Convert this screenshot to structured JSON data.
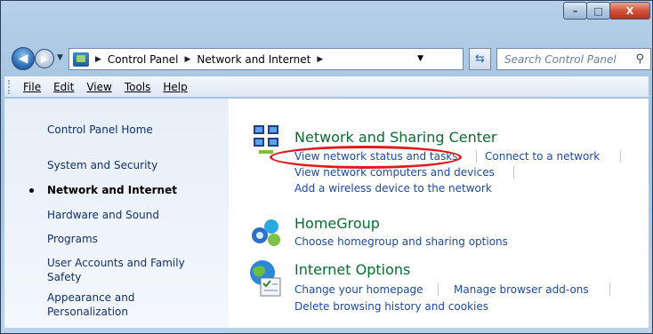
{
  "window": {
    "caption_buttons": [
      "–",
      "□",
      "X"
    ]
  },
  "address_bar": {
    "crumbs": [
      "Control Panel",
      "Network and Internet"
    ],
    "search_placeholder": "Search Control Panel"
  },
  "menu": [
    "File",
    "Edit",
    "View",
    "Tools",
    "Help"
  ],
  "sidebar": {
    "items": [
      {
        "label": "Control Panel Home"
      },
      {
        "label": "System and Security"
      },
      {
        "label": "Network and Internet",
        "active": true
      },
      {
        "label": "Hardware and Sound"
      },
      {
        "label": "Programs"
      },
      {
        "label": "User Accounts and Family"
      },
      {
        "label": "Safety"
      },
      {
        "label": "Appearance and"
      },
      {
        "label": "Personalization"
      }
    ]
  },
  "sections": [
    {
      "title": "Network and Sharing Center",
      "icon": "network-sharing-icon",
      "links": [
        "View network status and tasks",
        "Connect to a network",
        "View network computers and devices",
        "Add a wireless device to the network"
      ]
    },
    {
      "title": "HomeGroup",
      "icon": "homegroup-icon",
      "links": [
        "Choose homegroup and sharing options"
      ]
    },
    {
      "title": "Internet Options",
      "icon": "internet-options-icon",
      "links": [
        "Change your homepage",
        "Manage browser add-ons",
        "Delete browsing history and cookies"
      ]
    }
  ],
  "annotation": {
    "color": "#e0191d"
  }
}
